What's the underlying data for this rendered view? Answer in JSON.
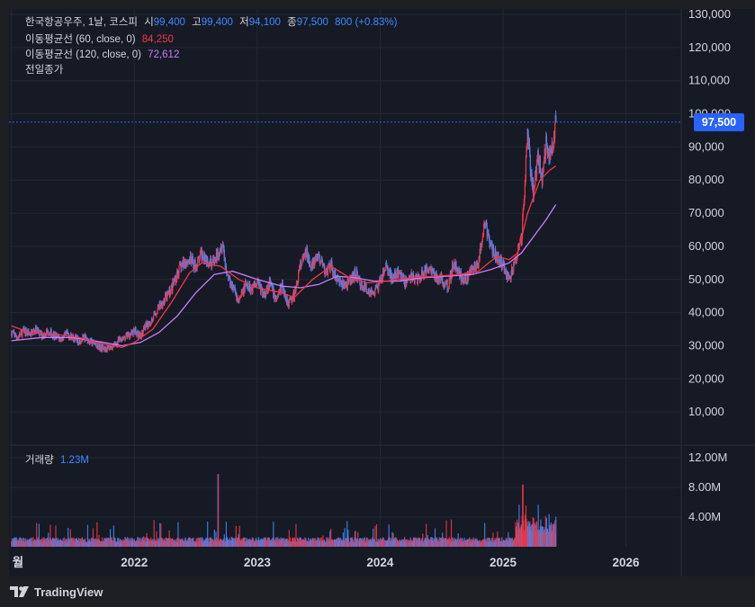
{
  "legend": {
    "symbol": "한국항공우주, 1날, 코스피",
    "open_label": "시",
    "open_value": "99,400",
    "high_label": "고",
    "high_value": "99,400",
    "low_label": "저",
    "low_value": "94,100",
    "close_label": "종",
    "close_value": "97,500",
    "change": "800 (+0.83%)",
    "ma60_label": "이동평균선 (60, close, 0)",
    "ma60_value": "84,250",
    "ma120_label": "이동평균선 (120, close, 0)",
    "ma120_value": "72,612",
    "prev_close_label": "전일종가",
    "volume_label": "거래량",
    "volume_value": "1.23M"
  },
  "price_tag": "97,500",
  "brand": {
    "name": "TradingView",
    "icon": "tradingview-logo-icon"
  },
  "colors": {
    "up": "#f23645",
    "down": "#3d8bfd",
    "ma60": "#f23645",
    "ma120": "#c77dff",
    "price_line": "#2962ff"
  },
  "chart_data": {
    "type": "candlestick",
    "price_axis": {
      "ylim": [
        0,
        130000
      ],
      "ticks": [
        10000,
        20000,
        30000,
        40000,
        50000,
        60000,
        70000,
        80000,
        90000,
        100000,
        110000,
        120000,
        130000
      ],
      "tick_labels": [
        "10,000",
        "20,000",
        "30,000",
        "40,000",
        "50,000",
        "60,000",
        "70,000",
        "80,000",
        "90,000",
        "100,000",
        "110,000",
        "120,000",
        "130,000"
      ]
    },
    "volume_axis": {
      "ylim": [
        0,
        12000000
      ],
      "ticks": [
        4000000,
        8000000,
        12000000
      ],
      "tick_labels": [
        "4.00M",
        "8.00M",
        "12.00M"
      ]
    },
    "time_axis": {
      "labels": [
        "월",
        "2022",
        "2023",
        "2024",
        "2025",
        "2026"
      ],
      "positions": [
        2021.0,
        2022.0,
        2023.0,
        2024.0,
        2025.0,
        2026.0
      ],
      "xlim": [
        2020.98,
        2026.45
      ]
    },
    "last_price": 97500,
    "price": [
      [
        2021.0,
        34000
      ],
      [
        2021.05,
        32500
      ],
      [
        2021.1,
        34500
      ],
      [
        2021.15,
        33500
      ],
      [
        2021.2,
        35000
      ],
      [
        2021.25,
        33000
      ],
      [
        2021.3,
        34500
      ],
      [
        2021.35,
        33000
      ],
      [
        2021.4,
        32000
      ],
      [
        2021.45,
        33500
      ],
      [
        2021.5,
        32500
      ],
      [
        2021.55,
        31500
      ],
      [
        2021.6,
        32500
      ],
      [
        2021.65,
        31000
      ],
      [
        2021.7,
        30000
      ],
      [
        2021.75,
        29000
      ],
      [
        2021.8,
        29500
      ],
      [
        2021.85,
        30500
      ],
      [
        2021.9,
        32500
      ],
      [
        2021.95,
        33000
      ],
      [
        2022.0,
        34500
      ],
      [
        2022.05,
        33000
      ],
      [
        2022.1,
        36000
      ],
      [
        2022.15,
        38000
      ],
      [
        2022.2,
        42000
      ],
      [
        2022.25,
        44000
      ],
      [
        2022.3,
        47000
      ],
      [
        2022.35,
        52000
      ],
      [
        2022.4,
        55000
      ],
      [
        2022.45,
        56000
      ],
      [
        2022.5,
        54000
      ],
      [
        2022.55,
        58000
      ],
      [
        2022.6,
        56000
      ],
      [
        2022.65,
        55000
      ],
      [
        2022.7,
        60000
      ],
      [
        2022.72,
        61000
      ],
      [
        2022.75,
        52000
      ],
      [
        2022.8,
        48000
      ],
      [
        2022.85,
        43000
      ],
      [
        2022.9,
        48000
      ],
      [
        2022.95,
        47000
      ],
      [
        2023.0,
        50000
      ],
      [
        2023.05,
        45000
      ],
      [
        2023.1,
        49000
      ],
      [
        2023.15,
        44000
      ],
      [
        2023.2,
        48000
      ],
      [
        2023.25,
        43000
      ],
      [
        2023.3,
        45000
      ],
      [
        2023.35,
        54000
      ],
      [
        2023.4,
        58000
      ],
      [
        2023.45,
        54000
      ],
      [
        2023.5,
        57000
      ],
      [
        2023.55,
        52000
      ],
      [
        2023.6,
        54000
      ],
      [
        2023.65,
        50000
      ],
      [
        2023.7,
        48000
      ],
      [
        2023.75,
        49000
      ],
      [
        2023.8,
        52000
      ],
      [
        2023.85,
        48000
      ],
      [
        2023.9,
        47000
      ],
      [
        2023.95,
        46000
      ],
      [
        2024.0,
        49000
      ],
      [
        2024.05,
        54000
      ],
      [
        2024.1,
        50000
      ],
      [
        2024.15,
        52000
      ],
      [
        2024.2,
        49000
      ],
      [
        2024.25,
        51000
      ],
      [
        2024.3,
        50000
      ],
      [
        2024.35,
        52000
      ],
      [
        2024.4,
        54000
      ],
      [
        2024.45,
        51000
      ],
      [
        2024.5,
        50000
      ],
      [
        2024.55,
        48000
      ],
      [
        2024.6,
        55000
      ],
      [
        2024.65,
        51000
      ],
      [
        2024.7,
        50000
      ],
      [
        2024.75,
        53000
      ],
      [
        2024.8,
        55000
      ],
      [
        2024.85,
        67000
      ],
      [
        2024.9,
        60000
      ],
      [
        2024.95,
        57000
      ],
      [
        2025.0,
        54000
      ],
      [
        2025.05,
        50000
      ],
      [
        2025.1,
        55000
      ],
      [
        2025.15,
        62000
      ],
      [
        2025.18,
        80000
      ],
      [
        2025.2,
        95000
      ],
      [
        2025.22,
        85000
      ],
      [
        2025.25,
        75000
      ],
      [
        2025.28,
        88000
      ],
      [
        2025.32,
        80000
      ],
      [
        2025.35,
        92000
      ],
      [
        2025.38,
        86000
      ],
      [
        2025.4,
        90000
      ],
      [
        2025.43,
        97500
      ]
    ],
    "ma60": [
      [
        2021.0,
        36000
      ],
      [
        2021.15,
        34000
      ],
      [
        2021.35,
        33500
      ],
      [
        2021.55,
        32500
      ],
      [
        2021.75,
        30500
      ],
      [
        2021.9,
        29500
      ],
      [
        2022.0,
        31000
      ],
      [
        2022.15,
        35000
      ],
      [
        2022.3,
        43000
      ],
      [
        2022.45,
        52000
      ],
      [
        2022.55,
        55000
      ],
      [
        2022.7,
        54000
      ],
      [
        2022.85,
        50000
      ],
      [
        2023.0,
        47500
      ],
      [
        2023.2,
        46000
      ],
      [
        2023.3,
        44500
      ],
      [
        2023.45,
        50000
      ],
      [
        2023.6,
        54000
      ],
      [
        2023.75,
        50500
      ],
      [
        2023.9,
        49000
      ],
      [
        2024.05,
        49500
      ],
      [
        2024.25,
        50500
      ],
      [
        2024.45,
        51000
      ],
      [
        2024.65,
        51500
      ],
      [
        2024.8,
        52500
      ],
      [
        2024.95,
        57000
      ],
      [
        2025.05,
        56000
      ],
      [
        2025.12,
        58000
      ],
      [
        2025.2,
        70000
      ],
      [
        2025.3,
        80000
      ],
      [
        2025.38,
        83000
      ],
      [
        2025.43,
        84250
      ]
    ],
    "ma120": [
      [
        2021.0,
        31500
      ],
      [
        2021.25,
        32500
      ],
      [
        2021.5,
        32500
      ],
      [
        2021.75,
        31000
      ],
      [
        2021.9,
        30000
      ],
      [
        2022.05,
        31000
      ],
      [
        2022.2,
        34000
      ],
      [
        2022.35,
        39000
      ],
      [
        2022.5,
        46000
      ],
      [
        2022.65,
        51500
      ],
      [
        2022.8,
        52500
      ],
      [
        2023.0,
        50000
      ],
      [
        2023.2,
        48000
      ],
      [
        2023.35,
        47500
      ],
      [
        2023.5,
        48500
      ],
      [
        2023.65,
        51000
      ],
      [
        2023.8,
        50500
      ],
      [
        2023.95,
        49500
      ],
      [
        2024.15,
        49500
      ],
      [
        2024.35,
        50500
      ],
      [
        2024.55,
        51000
      ],
      [
        2024.75,
        51500
      ],
      [
        2024.9,
        53000
      ],
      [
        2025.05,
        55000
      ],
      [
        2025.15,
        58000
      ],
      [
        2025.25,
        63000
      ],
      [
        2025.35,
        68000
      ],
      [
        2025.43,
        72612
      ]
    ],
    "volume_max": 12000000
  }
}
